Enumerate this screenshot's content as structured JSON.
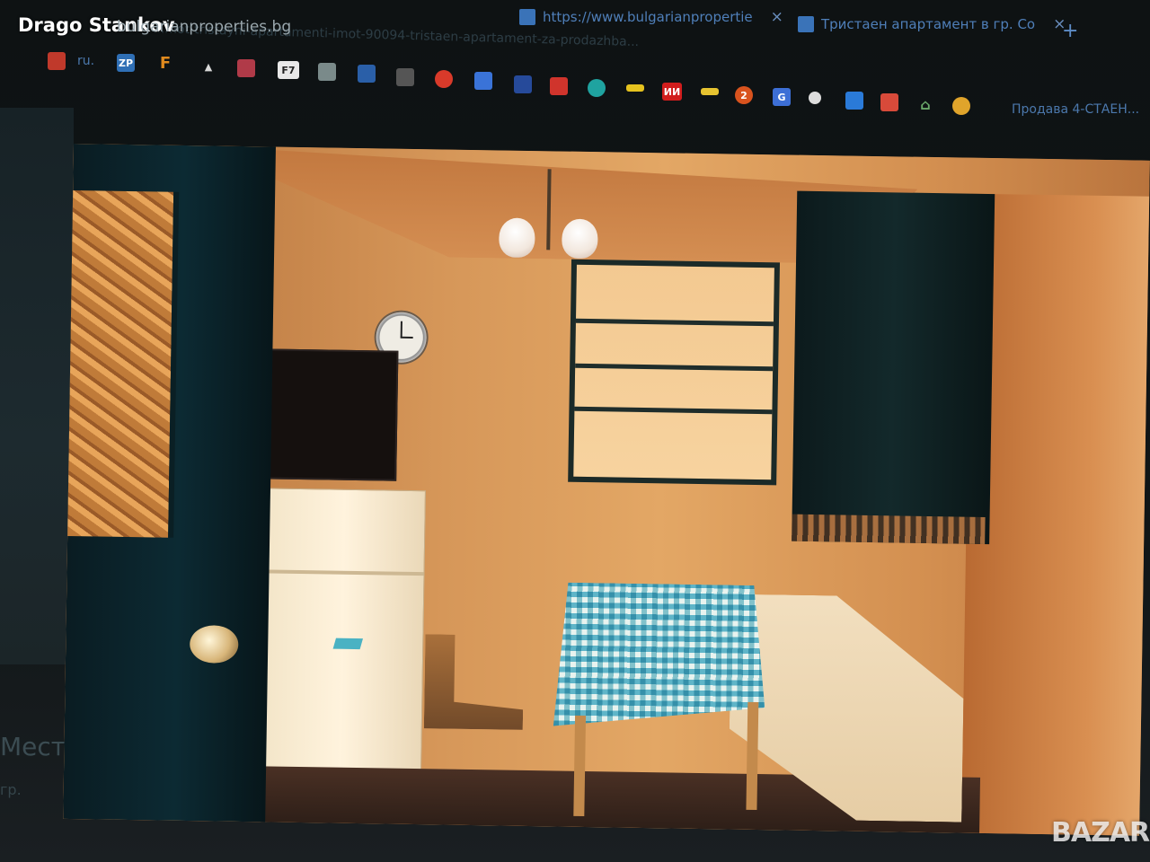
{
  "watermark": {
    "user": "Drago Stankov",
    "site_ghost": "bulgarianproperties.bg",
    "brand": "BAZAR"
  },
  "browser": {
    "tabs": [
      {
        "label": "https://www.bulgarianpropertie",
        "favicon": "site-favicon"
      },
      {
        "label": "Тристаен апартамент в гр. Со",
        "favicon": "site-favicon"
      }
    ],
    "new_tab": "+",
    "close": "×",
    "url_ghost": "...mot-tristayni-apartamenti-imot-90094-tristaen-apartament-za-prodazhba...",
    "bookmarks": [
      {
        "icon": "popcorn-icon",
        "color": "#c0392b",
        "text": ""
      },
      {
        "label": "ru."
      },
      {
        "icon": "zp-icon",
        "color": "#2f6fb5",
        "text": "ZP"
      },
      {
        "icon": "f-icon",
        "color": "#e08a1e",
        "text": "F"
      },
      {
        "icon": "triangle-icon",
        "color": "#d9d9d9",
        "text": "▲"
      },
      {
        "icon": "bookmark-icon",
        "color": "#b03a48",
        "text": ""
      },
      {
        "icon": "f7-icon",
        "color": "#e8e8e8",
        "text": "F7"
      },
      {
        "icon": "drone-icon",
        "color": "#7a8a8a",
        "text": ""
      },
      {
        "icon": "clapper-icon",
        "color": "#2a5fa8",
        "text": ""
      },
      {
        "icon": "camera-icon",
        "color": "#555",
        "text": ""
      },
      {
        "icon": "red-circle-icon",
        "color": "#d93a2a",
        "text": ""
      },
      {
        "icon": "arrow-icon",
        "color": "#3a73d8",
        "text": ""
      },
      {
        "icon": "square-icon",
        "color": "#264a9a",
        "text": ""
      },
      {
        "icon": "red-building-icon",
        "color": "#d0342c",
        "text": ""
      },
      {
        "icon": "teal-circle-icon",
        "color": "#1fa3a0",
        "text": ""
      },
      {
        "icon": "yellow-bar-icon",
        "color": "#e5c21e",
        "text": ""
      },
      {
        "icon": "im-icon",
        "color": "#d11d1d",
        "text": "ИИ"
      },
      {
        "icon": "yellow-tag-icon",
        "color": "#e6c330",
        "text": ""
      },
      {
        "icon": "two-icon",
        "color": "#d9531e",
        "text": "2"
      },
      {
        "icon": "google-icon",
        "color": "#3d6fd6",
        "text": "G"
      },
      {
        "icon": "circle-icon",
        "color": "#ddd",
        "text": ""
      },
      {
        "icon": "grid-icon",
        "color": "#2a7ad8",
        "text": ""
      },
      {
        "icon": "bag-icon",
        "color": "#d84a3a",
        "text": ""
      },
      {
        "icon": "home-icon",
        "color": "#6aa86a",
        "text": "⌂"
      },
      {
        "icon": "chrome-icon",
        "color": "#e0a42b",
        "text": ""
      },
      {
        "label": "Продава 4-СТАЕН..."
      }
    ]
  },
  "page_left": {
    "heading": "Место",
    "sub": "гр."
  }
}
